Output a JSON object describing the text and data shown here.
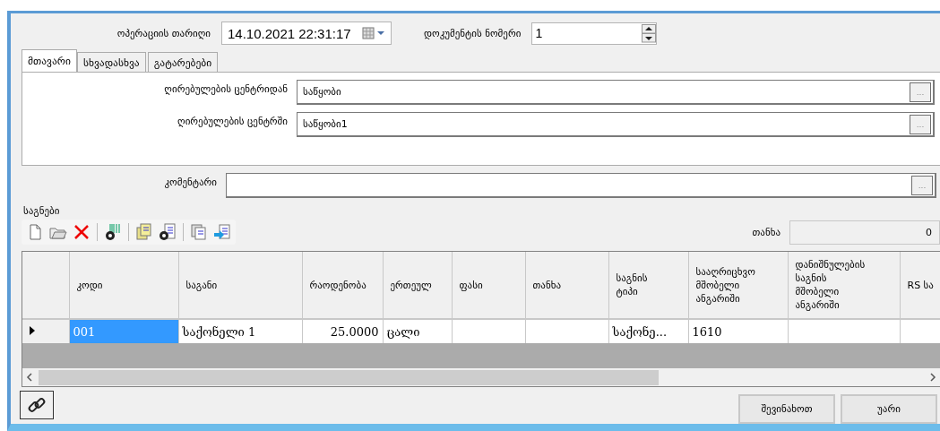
{
  "header": {
    "date_label": "ოპერაციის თარიღი",
    "date_value": "14.10.2021 22:31:17",
    "doc_label": "დოკუმენტის ნომერი",
    "doc_value": "1"
  },
  "tabs": [
    {
      "label": "მთავარი",
      "selected": true
    },
    {
      "label": "სხვადასხვა",
      "selected": false
    },
    {
      "label": "გატარებები",
      "selected": false
    }
  ],
  "tab_panel": {
    "fields": [
      {
        "label": "ღირებულების ცენტრიდან",
        "value": "საწყობი",
        "button": "..."
      },
      {
        "label": "ღირებულების ცენტრში",
        "value": "საწყობი1",
        "button": "..."
      }
    ]
  },
  "comment": {
    "label": "კომენტარი",
    "button": "..."
  },
  "items_group": {
    "title": "საგნები",
    "total_label": "თანხა",
    "total_value": "0",
    "table": {
      "columns": [
        "კოდი",
        "საგანი",
        "რაოდენობა",
        "ერთეულ",
        "ფასი",
        "თანხა",
        "საგნის\nტიპი",
        "სააღრიცხვო\nმშობელი\nანგარიში",
        "დანიშნულების\nსაგნის\nმშობელი\nანგარიში",
        "RS სა"
      ],
      "rows": [
        {
          "current": true,
          "cells": [
            {
              "text": "001",
              "selected": true
            },
            {
              "text": "საქონელი  1",
              "selected": false
            },
            {
              "text": "25.0000",
              "selected": false
            },
            {
              "text": "ცალი",
              "selected": false
            },
            {
              "selected": false
            },
            {
              "selected": false
            },
            {
              "text": "საქონე...",
              "selected": false
            },
            {
              "text": "1610",
              "selected": false
            },
            {
              "selected": false
            },
            {
              "selected": false
            }
          ]
        }
      ]
    }
  },
  "footer_buttons": [
    "შევინახოთ",
    "უარი"
  ]
}
